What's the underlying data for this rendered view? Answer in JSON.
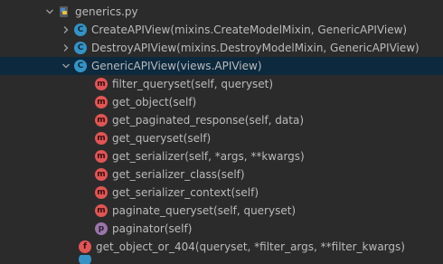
{
  "tree": {
    "file": {
      "label": "generics.py",
      "icon": "python-file-icon",
      "expanded": true
    },
    "classes": [
      {
        "label": "CreateAPIView(mixins.CreateModelMixin, GenericAPIView)",
        "icon": "class-icon",
        "glyph": "C",
        "expanded": false
      },
      {
        "label": "DestroyAPIView(mixins.DestroyModelMixin, GenericAPIView)",
        "icon": "class-icon",
        "glyph": "C",
        "expanded": false
      },
      {
        "label": "GenericAPIView(views.APIView)",
        "icon": "class-icon",
        "glyph": "C",
        "expanded": true,
        "selected": true
      }
    ],
    "members": [
      {
        "label": "filter_queryset(self, queryset)",
        "icon": "method-icon",
        "glyph": "m"
      },
      {
        "label": "get_object(self)",
        "icon": "method-icon",
        "glyph": "m"
      },
      {
        "label": "get_paginated_response(self, data)",
        "icon": "method-icon",
        "glyph": "m"
      },
      {
        "label": "get_queryset(self)",
        "icon": "method-icon",
        "glyph": "m"
      },
      {
        "label": "get_serializer(self, *args, **kwargs)",
        "icon": "method-icon",
        "glyph": "m"
      },
      {
        "label": "get_serializer_class(self)",
        "icon": "method-icon",
        "glyph": "m"
      },
      {
        "label": "get_serializer_context(self)",
        "icon": "method-icon",
        "glyph": "m"
      },
      {
        "label": "paginate_queryset(self, queryset)",
        "icon": "method-icon",
        "glyph": "m"
      },
      {
        "label": "paginator(self)",
        "icon": "property-icon",
        "glyph": "p"
      }
    ],
    "functions": [
      {
        "label": "get_object_or_404(queryset, *filter_args, **filter_kwargs)",
        "icon": "function-icon",
        "glyph": "f"
      }
    ]
  },
  "colors": {
    "background": "#2b2b2b",
    "selection": "#0d293e",
    "class_icon": "#3592c4",
    "method_icon": "#e05555",
    "property_icon": "#9876aa",
    "text": "#bbbbbb"
  }
}
